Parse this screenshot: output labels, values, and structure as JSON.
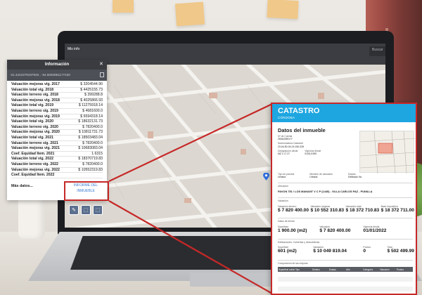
{
  "app": {
    "brand": "Mis info",
    "search_placeholder": "Buscar"
  },
  "info_panel": {
    "title": "Información",
    "coords": "-31.4242379197945 ; -64.5092891177430",
    "rows": [
      {
        "label": "Valuación mejoras vig. 2017",
        "value": "$ 3204544.90"
      },
      {
        "label": "Valuación total vig. 2018",
        "value": "$ 4425155.73"
      },
      {
        "label": "Valuación terreno vig. 2018",
        "value": "$ 399288.8"
      },
      {
        "label": "Valuación mejoras vig. 2018",
        "value": "$ 4025866.93"
      },
      {
        "label": "Valuación total vig. 2019",
        "value": "$ 11275918.14"
      },
      {
        "label": "Valuación terreno sig. 2019",
        "value": "$ 4681600.0"
      },
      {
        "label": "Valuación mejoras vig. 2019",
        "value": "$ 6594318.14"
      },
      {
        "label": "Valuación total vig. 2020",
        "value": "$ 18632131.73"
      },
      {
        "label": "Valuación terreno vig. 2020",
        "value": "$ 7820400.0"
      },
      {
        "label": "Valuación mejoras vig. 2020",
        "value": "$ 10811731.73"
      },
      {
        "label": "Valuación total vig. 2021",
        "value": "$ 18503483.04"
      },
      {
        "label": "Valuación terreno sig. 2021",
        "value": "$ 7820400.0"
      },
      {
        "label": "Valuación mejoras vig. 2021",
        "value": "$ 10683083.04"
      },
      {
        "label": "Coef. Equidad Item. 2021",
        "value": "1.6315"
      },
      {
        "label": "Valuación total vig. 2022",
        "value": "$ 18370719.83"
      },
      {
        "label": "Valuación terreno vig. 2022",
        "value": "$ 7820400.0"
      },
      {
        "label": "Valuación mejoras vig. 2022",
        "value": "$ 10552319.83"
      },
      {
        "label": "Coef. Equidad Item. 2022",
        "value": ""
      }
    ],
    "more": "Más datos...",
    "report_link": "INFORME DEL INMUEBLE"
  },
  "document": {
    "title": "CATASTRO",
    "subtitle": "CÓRDOBA",
    "section": "Datos del inmueble",
    "fields": [
      {
        "label": "Nº de Cuenta",
        "value": "250422891?7"
      },
      {
        "label": "Nomenclatura Catastral",
        "value": "23-04-50-04-01-030-028"
      },
      {
        "label": "Designación oficial",
        "value": "MZ 1 LT 27"
      },
      {
        "label": "Vigencia desde",
        "value": "01/01/1992"
      }
    ],
    "types": [
      {
        "label": "Tipo de parcela",
        "value": "Urbana"
      },
      {
        "label": "Mensión de valuación",
        "value": "Urbana"
      },
      {
        "label": "Estado",
        "value": "Edificado No"
      }
    ],
    "location_label": "Ubicación",
    "address": "PAVON 751 / LOS MANANT V C P (1445) - VILLA CARLOS PAZ - PUNILLA",
    "valuation_label": "Valuación",
    "valuations": [
      {
        "label": "Valuación terreno",
        "value": "$ 7 820 400.00"
      },
      {
        "label": "Valuación mejoras",
        "value": "$ 10 552 310.83"
      },
      {
        "label": "Valuación total",
        "value": "$ 18 372 710.83"
      },
      {
        "label": "Base Impositiva",
        "value": "$ 18 372 711.00"
      }
    ],
    "land_label": "Datos de tierras",
    "land": [
      {
        "label": "Superficie",
        "value": "1 900.00 (m2)"
      },
      {
        "label": "Valuación",
        "value": "$ 7 820 400.00"
      },
      {
        "label": "Vigencia desde",
        "value": "01/01/2022"
      }
    ],
    "buildings_label": "Edificaciones: Cubiertas y descubiertas",
    "buildings": [
      {
        "label": "Superficie",
        "value": "601 (m2)"
      },
      {
        "label": "Valuación",
        "value": "$ 10 049 819.04"
      },
      {
        "label": "Puntos",
        "value": "0"
      },
      {
        "label": "Total",
        "value": "$ 502 499.99"
      }
    ],
    "table_label": "Composición de las mejoras",
    "table_headers": [
      "Superficie cubierta",
      "Tipo",
      "Destino",
      "Estado",
      "Año",
      "Categoría",
      "Valuación",
      "Puntos"
    ]
  },
  "colors": {
    "brand_blue": "#1ea6e0",
    "callout_red": "#c62828",
    "link_blue": "#3a7bd5"
  }
}
